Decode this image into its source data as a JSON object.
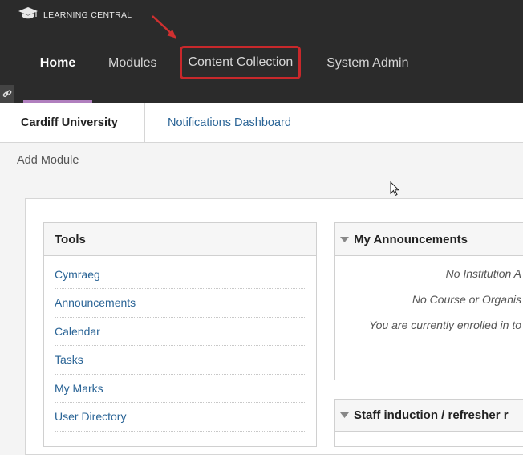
{
  "brand": {
    "name": "LEARNING CENTRAL",
    "logo_icon": "mortarboard-icon"
  },
  "nav": {
    "items": [
      {
        "label": "Home",
        "active": true
      },
      {
        "label": "Modules"
      },
      {
        "label": "Content Collection",
        "highlighted": true
      },
      {
        "label": "System Admin"
      }
    ]
  },
  "tabs": {
    "active": "Cardiff University",
    "link": "Notifications Dashboard"
  },
  "add_module": "Add Module",
  "tools": {
    "title": "Tools",
    "items": [
      "Cymraeg",
      "Announcements",
      "Calendar",
      "Tasks",
      "My Marks",
      "User Directory"
    ]
  },
  "announcements": {
    "title": "My Announcements",
    "lines": [
      "No Institution A",
      "No Course or Organis",
      "You are currently enrolled in to"
    ]
  },
  "staff": {
    "title": "Staff induction / refresher r"
  },
  "colors": {
    "header_bg": "#2b2b2b",
    "accent": "#b07fbe",
    "highlight": "#c8282b",
    "link": "#2a6496"
  }
}
